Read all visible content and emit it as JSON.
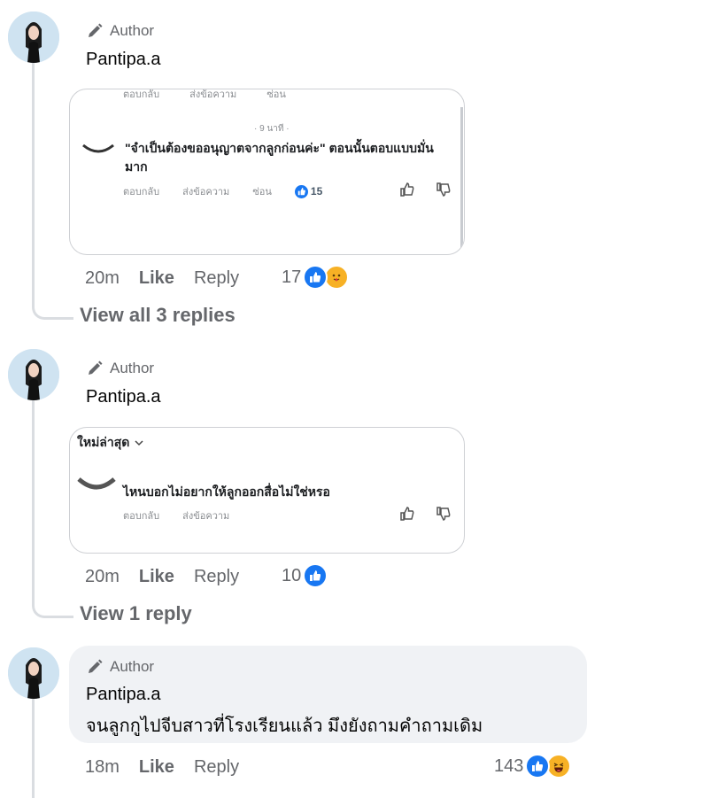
{
  "comments": [
    {
      "author_badge": "Author",
      "name": "Pantipa.a",
      "card": {
        "top_row": [
          "ตอบกลับ",
          "ส่งข้อความ",
          "ซ่อน"
        ],
        "time": "· 9 นาที ·",
        "text": "\"จำเป็นต้องขออนุญาตจากลูกก่อนค่ะ\" ตอนนั้นตอบแบบมั่นมาก",
        "actions": [
          "ตอบกลับ",
          "ส่งข้อความ",
          "ซ่อน"
        ],
        "like_count": "15"
      },
      "time": "20m",
      "like": "Like",
      "reply": "Reply",
      "reaction_count": "17",
      "view_replies": "View all 3 replies"
    },
    {
      "author_badge": "Author",
      "name": "Pantipa.a",
      "card": {
        "sort_label": "ใหม่ล่าสุด",
        "text": "ไหนบอกไม่อยากให้ลูกออกสื่อไม่ใช่หรอ",
        "actions": [
          "ตอบกลับ",
          "ส่งข้อความ"
        ]
      },
      "time": "20m",
      "like": "Like",
      "reply": "Reply",
      "reaction_count": "10",
      "view_replies": "View 1 reply"
    },
    {
      "author_badge": "Author",
      "name": "Pantipa.a",
      "text": "จนลูกกูไปจีบสาวที่โรงเรียนแล้ว มึงยังถามคำถามเดิม",
      "time": "18m",
      "like": "Like",
      "reply": "Reply",
      "reaction_count": "143"
    }
  ],
  "colors": {
    "like_blue": "#1877f2",
    "muted": "#65676b",
    "bubble": "#f0f2f5",
    "line": "#dadde1"
  }
}
